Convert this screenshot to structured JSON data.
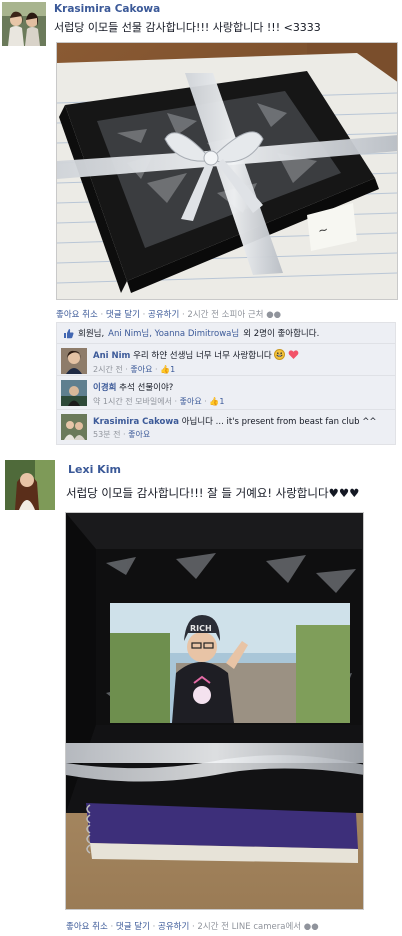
{
  "post1": {
    "author": "Krasimira Cakowa",
    "text": "서럽당 이모들 선물 감사합니다!!! 사랑합니다 !!! <3333",
    "actions": {
      "unlike": "좋아요 취소",
      "comment": "댓글 달기",
      "share": "공유하기",
      "meta": "2시간 전 소피아 근처"
    },
    "likes": {
      "prefix": "회원님,",
      "names": "Ani Nim님, Yoanna Dimitrowa님",
      "suffix": "외 2명이 좋아합니다."
    },
    "comments": [
      {
        "name": "Ani Nim",
        "text": "우리 하얀 선생님 너무 너무 사랑합니다",
        "time": "2시간 전",
        "like_label": "좋아요",
        "like_count": "1"
      },
      {
        "name": "이경희",
        "text": "추석 선물이야?",
        "time": "약 1시간 전 모바일에서",
        "like_label": "좋아요",
        "like_count": "1"
      },
      {
        "name": "Krasimira Cakowa",
        "text": "아닙니다 ... it's present from beast fan club ^^",
        "time": "53분 전",
        "like_label": "좋아요",
        "like_count": ""
      }
    ]
  },
  "post2": {
    "author": "Lexi Kim",
    "text": "서럽당 이모들 감사합니다!!! 잘 들 거예요! 사랑합니다♥♥♥",
    "cap_text": "RICH",
    "actions": {
      "unlike": "좋아요 취소",
      "comment": "댓글 달기",
      "share": "공유하기",
      "meta": "2시간 전 LINE camera에서"
    }
  },
  "colors": {
    "link": "#3b5998",
    "muted": "#90949c",
    "comment_bg": "#edeff4",
    "like_blue": "#4267b2"
  }
}
